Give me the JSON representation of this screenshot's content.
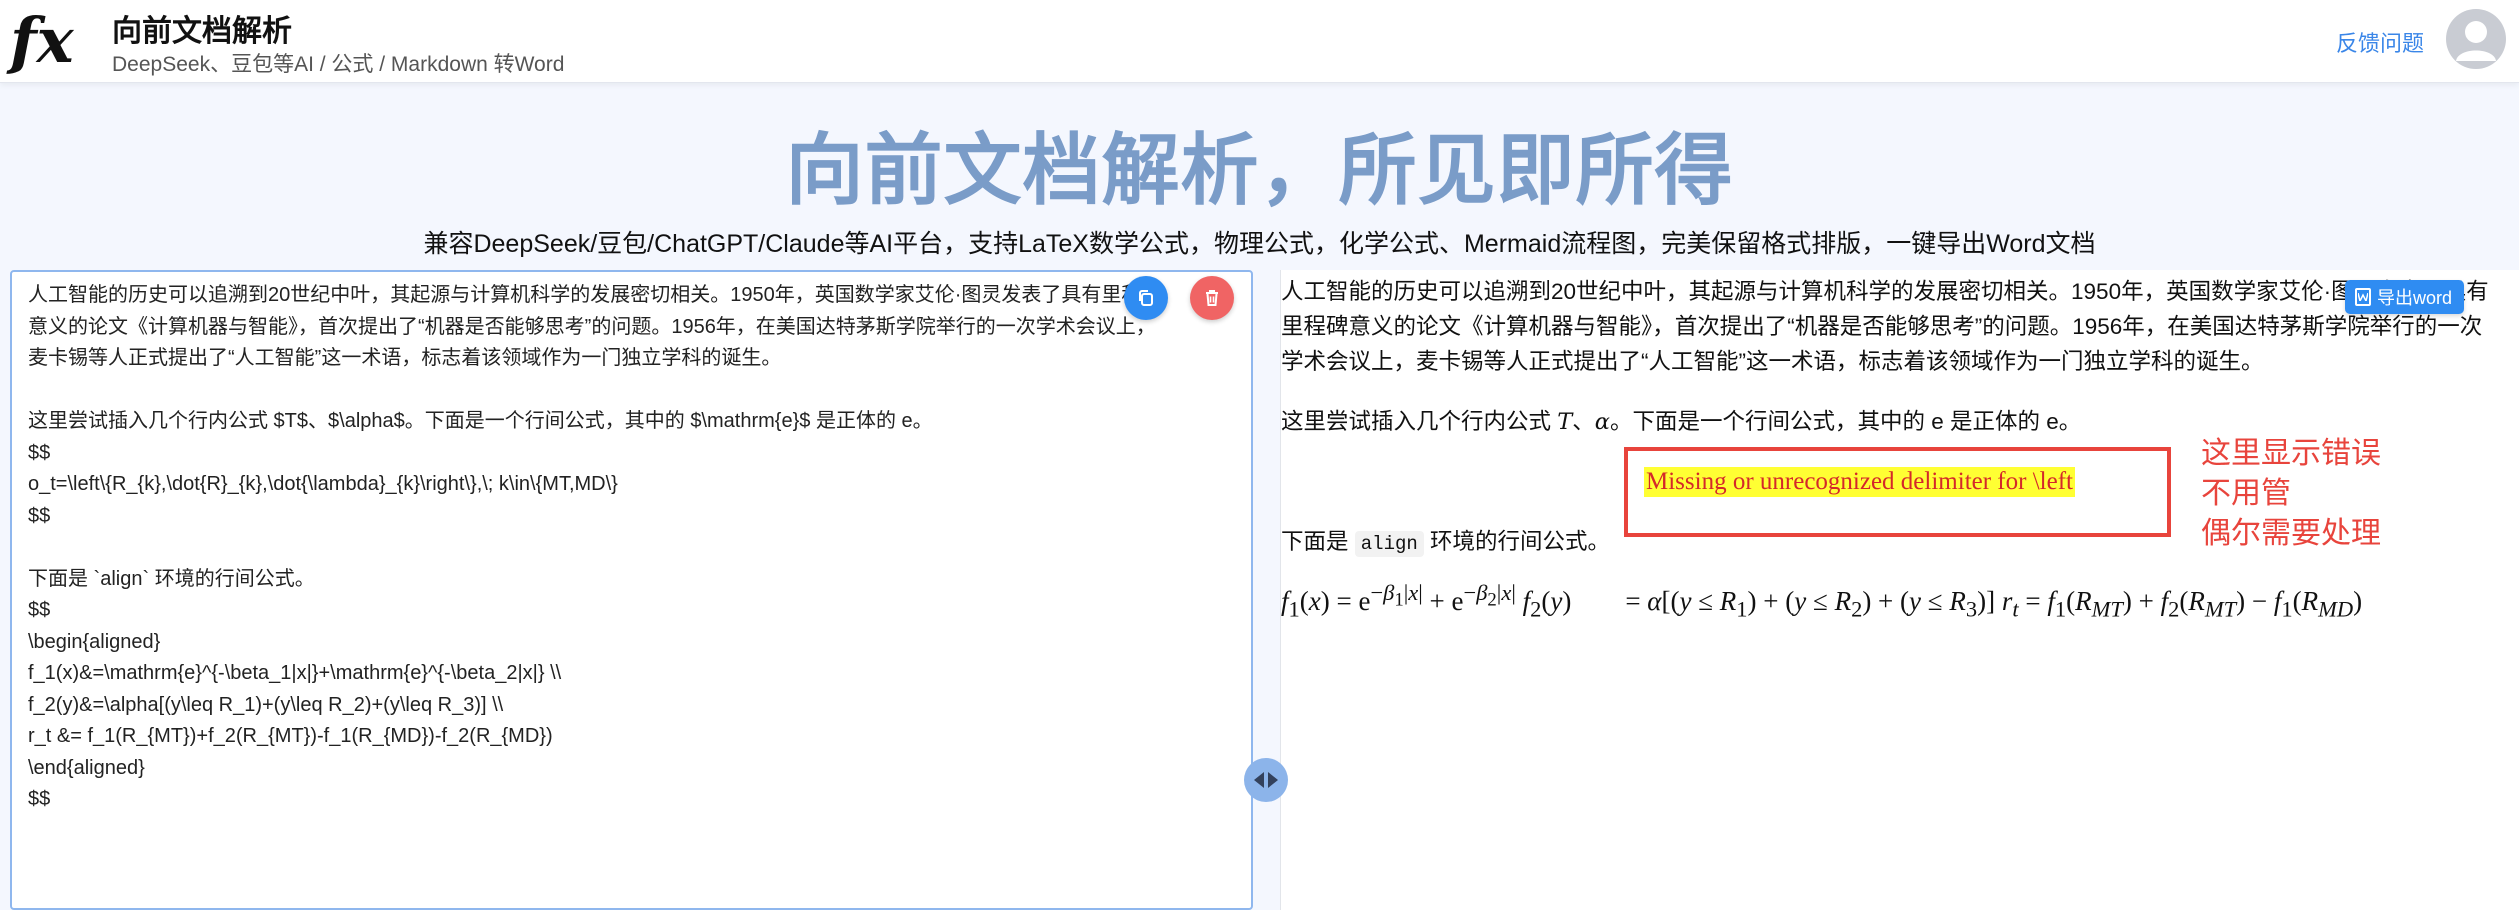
{
  "header": {
    "title": "向前文档解析",
    "subtitle": "DeepSeek、豆包等AI / 公式 / Markdown 转Word",
    "feedback_label": "反馈问题"
  },
  "hero": {
    "title": "向前文档解析，所见即所得",
    "subtitle": "兼容DeepSeek/豆包/ChatGPT/Claude等AI平台，支持LaTeX数学公式，物理公式，化学公式、Mermaid流程图，完美保留格式排版，一键导出Word文档"
  },
  "editor": {
    "content": "人工智能的历史可以追溯到20世纪中叶，其起源与计算机科学的发展密切相关。1950年，英国数学家艾伦·图灵发表了具有里程碑\n意义的论文《计算机器与智能》，首次提出了“机器是否能够思考”的问题。1956年，在美国达特茅斯学院举行的一次学术会议上，\n麦卡锡等人正式提出了“人工智能”这一术语，标志着该领域作为一门独立学科的诞生。\n\n这里尝试插入几个行内公式 $T$、$\\alpha$。下面是一个行间公式，其中的 $\\mathrm{e}$ 是正体的 e。\n$$\no_t=\\left\\{R_{k},\\dot{R}_{k},\\dot{\\lambda}_{k}\\right\\},\\; k\\in\\{MT,MD\\}\n$$\n\n下面是 `align` 环境的行间公式。\n$$\n\\begin{aligned}\nf_1(x)&=\\mathrm{e}^{-\\beta_1|x|}+\\mathrm{e}^{-\\beta_2|x|} \\\\\nf_2(y)&=\\alpha[(y\\leq R_1)+(y\\leq R_2)+(y\\leq R_3)] \\\\\nr_t &= f_1(R_{MT})+f_2(R_{MT})-f_1(R_{MD})-f_2(R_{MD})\n\\end{aligned}\n$$"
  },
  "preview": {
    "paragraph1": "人工智能的历史可以追溯到20世纪中叶，其起源与计算机科学的发展密切相关。1950年，英国数学家艾伦·图灵发表了具有里程碑意义的论文《计算机器与智能》，首次提出了“机器是否能够思考”的问题。1956年，在美国达特茅斯学院举行的一次学术会议上，麦卡锡等人正式提出了“人工智能”这一术语，标志着该领域作为一门独立学科的诞生。",
    "p2_a": "这里尝试插入几个行内公式 ",
    "p2_math1": "T",
    "p2_sep": "、",
    "p2_math2": "α",
    "p2_b": "。下面是一个行间公式，其中的 e 是正体的 e。",
    "error_text": "Missing or unrecognized delimiter for \\left",
    "annotation_line1": "这里显示错误",
    "annotation_line2": "不用管",
    "annotation_line3": "偶尔需要处理",
    "p3_a": "下面是 ",
    "p3_code": "align",
    "p3_b": " 环境的行间公式。",
    "export_label": "导出word"
  },
  "colors": {
    "accent": "#2f8cf2",
    "delete": "#f06464",
    "hero_title": "#7a9cc8",
    "error_border": "#e8443c",
    "error_highlight": "#ffff33"
  },
  "icons": [
    "fx-logo-icon",
    "avatar-icon",
    "copy-icon",
    "trash-icon",
    "resize-arrows-icon",
    "word-doc-icon"
  ]
}
